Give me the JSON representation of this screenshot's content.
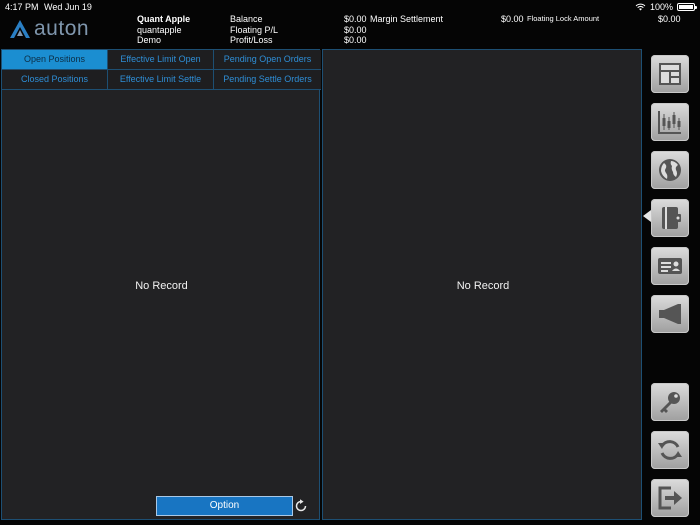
{
  "status_bar": {
    "time": "4:17 PM",
    "date": "Wed Jun 19",
    "battery": "100%",
    "battery_level": 1.0
  },
  "logo": {
    "text": "auton"
  },
  "account": {
    "name": "Quant Apple",
    "username": "quantapple",
    "type": "Demo",
    "balance_label": "Balance",
    "balance_value": "$0.00",
    "floating_label": "Floating P/L",
    "floating_value": "$0.00",
    "profit_label": "Profit/Loss",
    "profit_value": "$0.00",
    "margin_label": "Margin Settlement",
    "margin_value": "$0.00",
    "lock_label": "Floating Lock Amount",
    "lock_value": "$0.00"
  },
  "tabs": [
    {
      "label": "Open Positions",
      "active": true
    },
    {
      "label": "Effective Limit Open",
      "active": false
    },
    {
      "label": "Pending Open Orders",
      "active": false
    },
    {
      "label": "Closed Positions",
      "active": false
    },
    {
      "label": "Effective Limit Settle",
      "active": false
    },
    {
      "label": "Pending Settle Orders",
      "active": false
    }
  ],
  "left_panel": {
    "empty_text": "No Record",
    "option_label": "Option"
  },
  "right_panel": {
    "empty_text": "No Record"
  },
  "side_toolbar": {
    "items": [
      {
        "icon": "dashboard-icon"
      },
      {
        "icon": "chart-icon"
      },
      {
        "icon": "globe-icon"
      },
      {
        "icon": "wallet-icon",
        "active": true
      },
      {
        "icon": "id-card-icon"
      },
      {
        "icon": "megaphone-icon"
      },
      {
        "icon": "key-icon"
      },
      {
        "icon": "sync-icon"
      },
      {
        "icon": "logout-icon"
      }
    ]
  },
  "colors": {
    "accent": "#1b8ed1",
    "tab_text": "#2e8ed6",
    "panel_bg": "#222224",
    "border": "#1d4f73",
    "background": "#050505"
  }
}
